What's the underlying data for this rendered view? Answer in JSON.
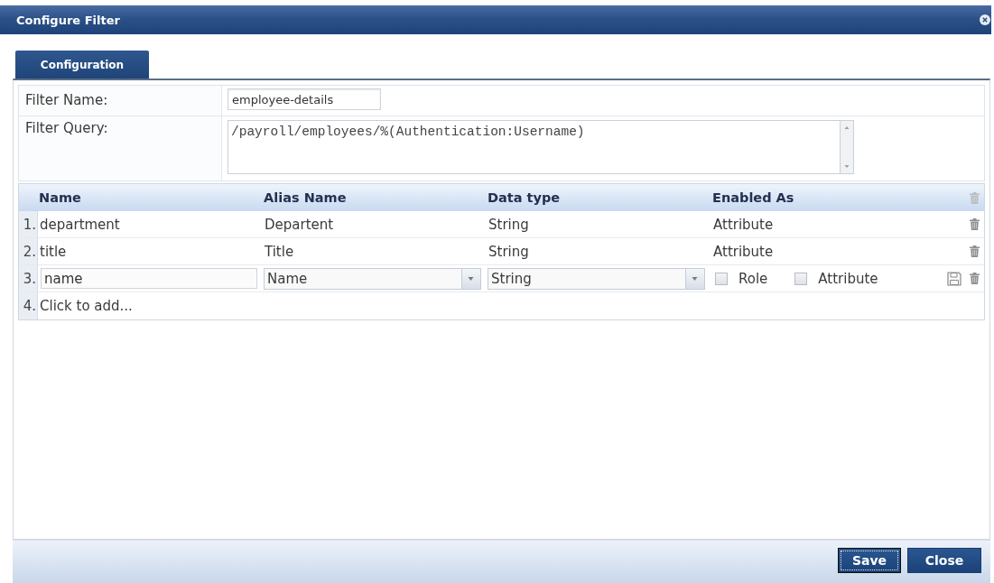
{
  "window": {
    "title": "Configure Filter"
  },
  "tabs": [
    {
      "label": "Configuration",
      "selected": true
    }
  ],
  "form": {
    "fields": [
      {
        "kind": "input",
        "label": "Filter Name:",
        "value": "employee-details"
      },
      {
        "kind": "textarea",
        "label": "Filter Query:",
        "value": "/payroll/employees/%(Authentication:Username)"
      }
    ]
  },
  "grid": {
    "columns": [
      "Name",
      "Alias Name",
      "Data type",
      "Enabled As"
    ],
    "rows": [
      {
        "kind": "view",
        "index": "1.",
        "name": "department",
        "alias": "Departent",
        "data_type": "String",
        "enabled_as": "Attribute"
      },
      {
        "kind": "view",
        "index": "2.",
        "name": "title",
        "alias": "Title",
        "data_type": "String",
        "enabled_as": "Attribute"
      },
      {
        "kind": "edit",
        "index": "3.",
        "name": "name",
        "alias": "Name",
        "data_type": "String",
        "options": [
          {
            "label": "Role",
            "checked": false
          },
          {
            "label": "Attribute",
            "checked": false
          }
        ]
      },
      {
        "kind": "add",
        "index": "4.",
        "text": "Click to add..."
      }
    ]
  },
  "buttons": [
    {
      "label": "Save",
      "focused": true
    },
    {
      "label": "Close",
      "focused": false
    }
  ]
}
